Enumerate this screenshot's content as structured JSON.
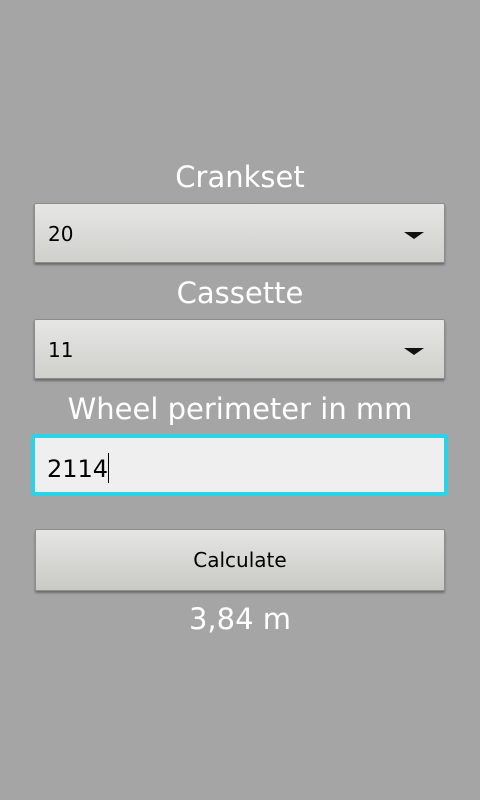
{
  "crankset": {
    "label": "Crankset",
    "value": "20"
  },
  "cassette": {
    "label": "Cassette",
    "value": "11"
  },
  "wheel": {
    "label": "Wheel perimeter in mm",
    "value": "2114"
  },
  "calculate_label": "Calculate",
  "result": "3,84 m",
  "colors": {
    "background": "#a5a5a5",
    "focus": "#2bd3e6"
  }
}
